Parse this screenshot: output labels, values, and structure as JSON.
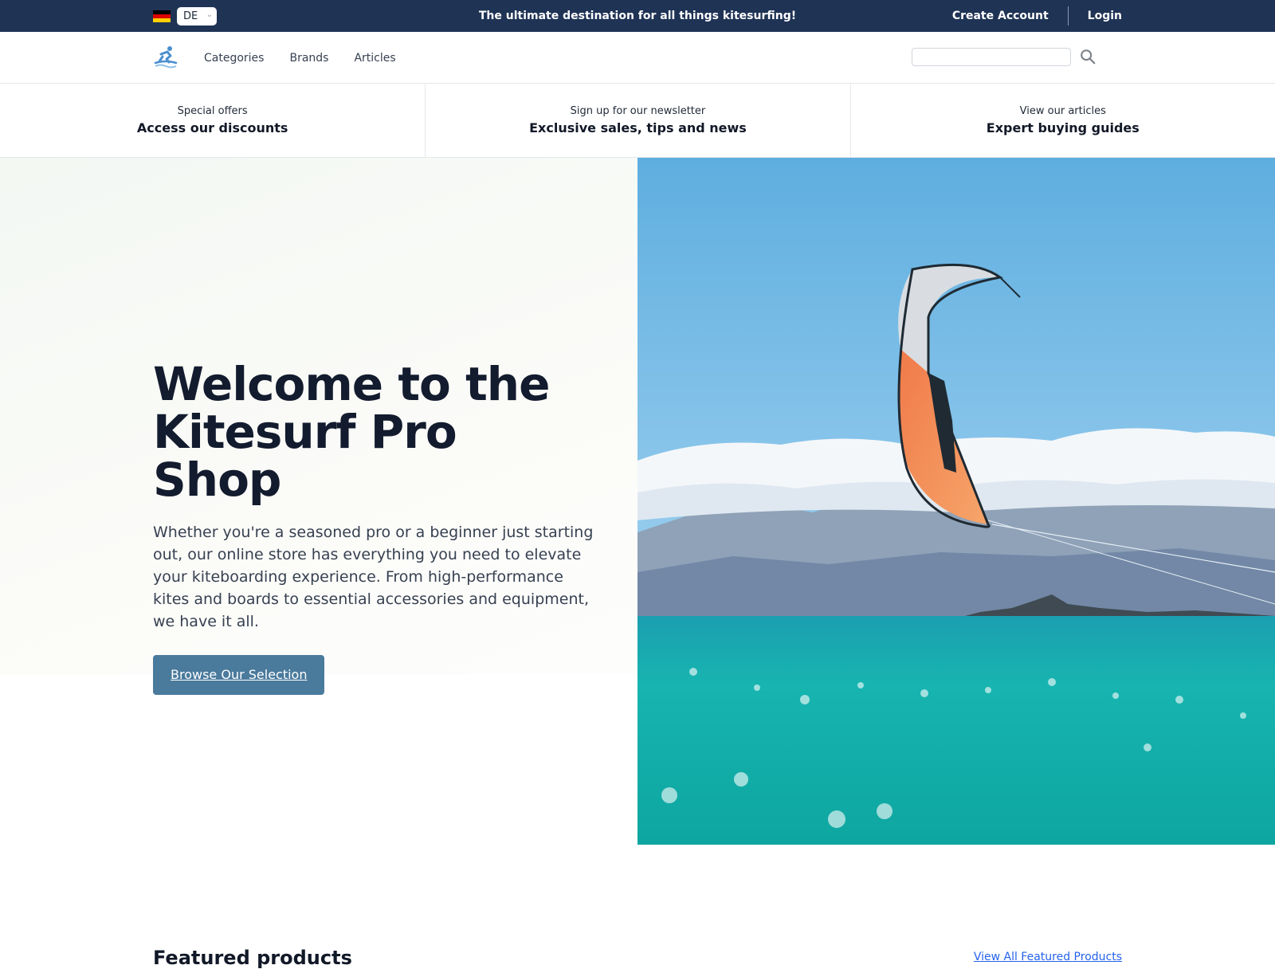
{
  "topbar": {
    "language_code": "DE",
    "announcement": "The ultimate destination for all things kitesurfing!",
    "create_account": "Create Account",
    "login": "Login"
  },
  "nav": {
    "links": [
      "Categories",
      "Brands",
      "Articles"
    ],
    "search_placeholder": ""
  },
  "promos": [
    {
      "small": "Special offers",
      "big": "Access our discounts"
    },
    {
      "small": "Sign up for our newsletter",
      "big": "Exclusive sales, tips and news"
    },
    {
      "small": "View our articles",
      "big": "Expert buying guides"
    }
  ],
  "hero": {
    "title_line1": "Welcome to the",
    "title_line2": "Kitesurf Pro Shop",
    "description": "Whether you're a seasoned pro or a beginner just starting out, our online store has everything you need to elevate your kiteboarding experience. From high-performance kites and boards to essential accessories and equipment, we have it all.",
    "cta": "Browse Our Selection"
  },
  "featured": {
    "title": "Featured products",
    "view_all": "View All Featured Products"
  },
  "colors": {
    "topbar_bg": "#1f3355",
    "cta_bg": "#4a7a9c",
    "brand_blue": "#3b82c4"
  },
  "icons": {
    "logo": "kitesurfer-logo-icon",
    "search": "search-icon",
    "dropdown": "chevron-down-icon",
    "flag": "germany-flag-icon"
  }
}
